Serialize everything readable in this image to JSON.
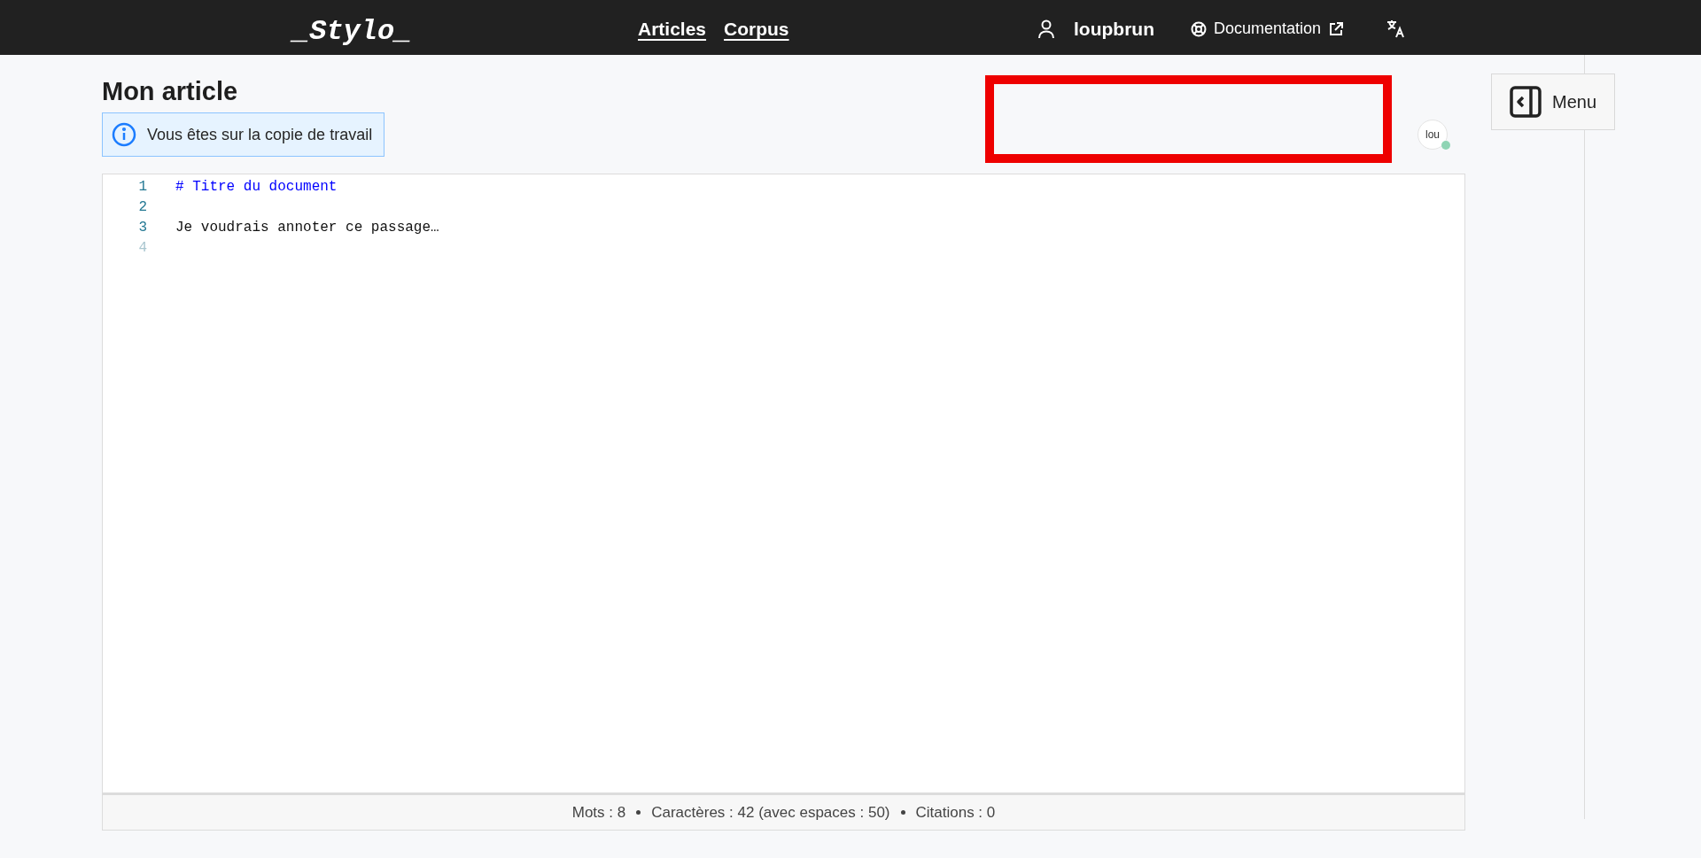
{
  "header": {
    "logo": "_Stylo_",
    "nav": [
      "Articles",
      "Corpus"
    ],
    "user": "loupbrun",
    "documentation": "Documentation"
  },
  "article": {
    "title": "Mon article",
    "notice": "Vous êtes sur la copie de travail"
  },
  "collaborators": [
    {
      "initials": "lou",
      "color": "#8fd4b4"
    }
  ],
  "menu_button": "Menu",
  "editor": {
    "lines": [
      {
        "number": "1",
        "text": "# Titre du document",
        "kind": "heading",
        "muted": false
      },
      {
        "number": "2",
        "muted": false
      },
      {
        "number": "3",
        "text": "Je voudrais annoter ce passage…",
        "kind": "plain",
        "muted": false
      },
      {
        "number": "4",
        "muted": true
      }
    ]
  },
  "status_bar": [
    "Mots : 8",
    "Caractères : 42 (avec espaces : 50)",
    "Citations : 0"
  ]
}
